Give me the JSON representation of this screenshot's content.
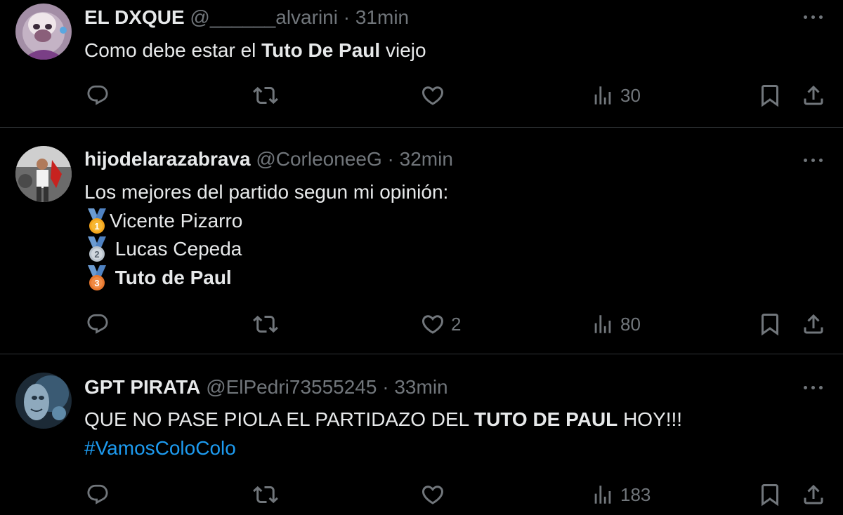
{
  "tweets": [
    {
      "name": "EL DXQUE",
      "handle": "@______alvarini",
      "separator": "·",
      "time": "31min",
      "text": {
        "pre": "Como debe estar el ",
        "bold": "Tuto De Paul",
        "post": " viejo"
      },
      "metrics": {
        "replies": "",
        "reposts": "",
        "likes": "",
        "views": "30"
      }
    },
    {
      "name": "hijodelarazabrava",
      "handle": "@CorleoneeG",
      "separator": "·",
      "time": "32min",
      "text": {
        "intro": "Los mejores del partido segun mi opinión:",
        "ranking": [
          {
            "medal_number": "1",
            "medal_color": "#f4a51c",
            "player": "Vicente Pizarro"
          },
          {
            "medal_number": "2",
            "medal_color": "#b8c2cc",
            "player": "Lucas Cepeda"
          },
          {
            "medal_number": "3",
            "medal_color": "#e8772e",
            "player": "Tuto de Paul"
          }
        ]
      },
      "metrics": {
        "replies": "",
        "reposts": "",
        "likes": "2",
        "views": "80"
      }
    },
    {
      "name": "GPT PIRATA",
      "handle": "@ElPedri73555245",
      "separator": "·",
      "time": "33min",
      "text": {
        "pre": "QUE NO PASE PIOLA EL PARTIDAZO DEL ",
        "bold": "TUTO DE PAUL",
        "post": " HOY!!!",
        "hashtag": "#VamosColoColo"
      },
      "metrics": {
        "replies": "",
        "reposts": "",
        "likes": "",
        "views": "183"
      }
    }
  ],
  "icons": {
    "reply": "reply-icon",
    "repost": "repost-icon",
    "like": "heart-icon",
    "views": "views-icon",
    "bookmark": "bookmark-icon",
    "share": "share-icon",
    "more": "more-options-icon"
  },
  "colors": {
    "background": "#000000",
    "text": "#e7e9ea",
    "muted": "#71767b",
    "link": "#1d9bf0",
    "divider": "#2f3336"
  }
}
